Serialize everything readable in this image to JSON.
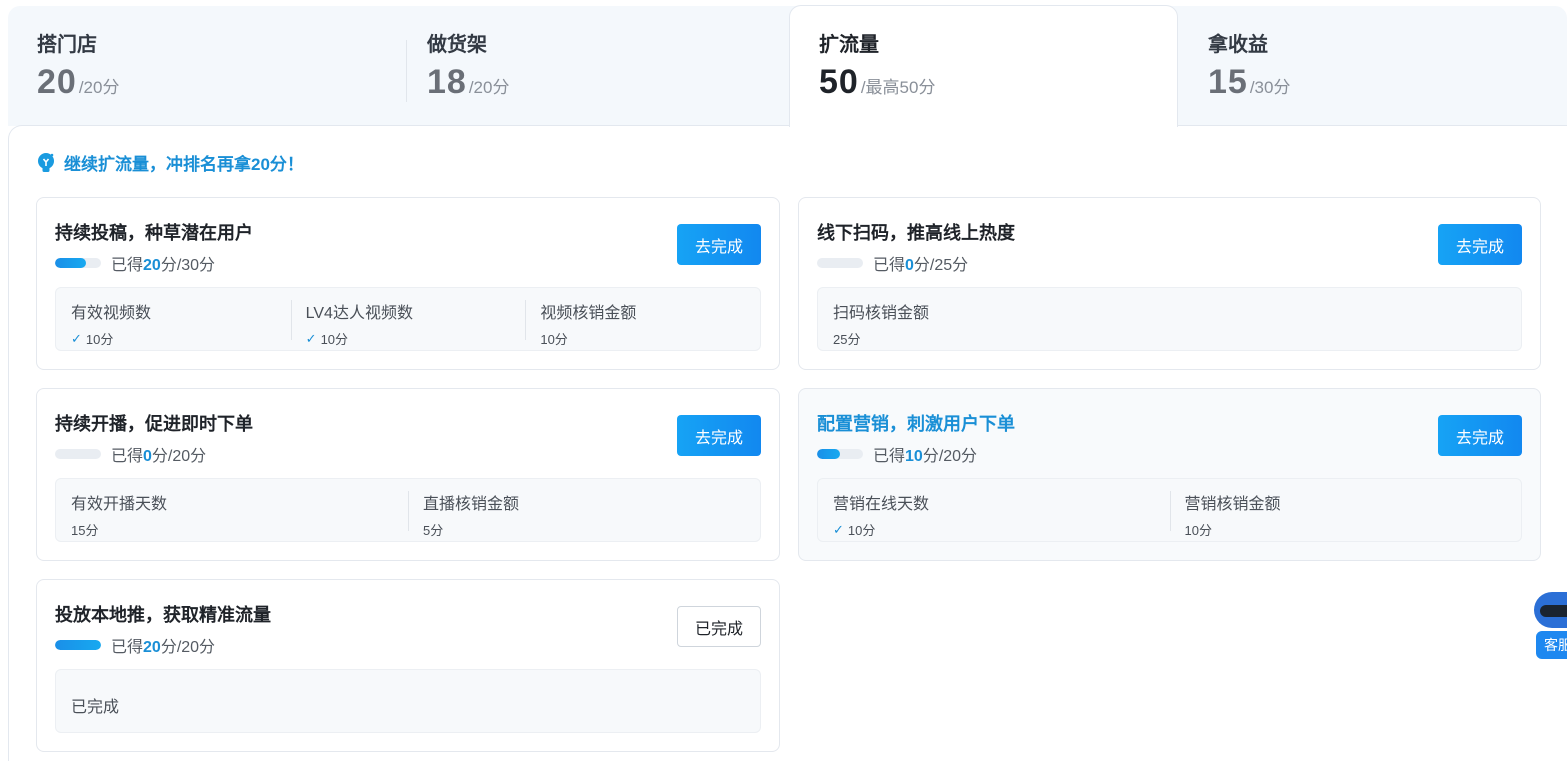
{
  "tabs": [
    {
      "title": "搭门店",
      "score": "20",
      "total": "/20分"
    },
    {
      "title": "做货架",
      "score": "18",
      "total": "/20分"
    },
    {
      "title": "扩流量",
      "score": "50",
      "total": "/最高50分"
    },
    {
      "title": "拿收益",
      "score": "15",
      "total": "/30分"
    }
  ],
  "hint": "继续扩流量，冲排名再拿20分！",
  "progress_prefix": "已得",
  "tasks": [
    {
      "title": "持续投稿，种草潜在用户",
      "earned": "20",
      "total": "分/30分",
      "fraction": 0.667,
      "button": "去完成",
      "items": [
        {
          "label": "有效视频数",
          "value": "10分",
          "checked": true
        },
        {
          "label": "LV4达人视频数",
          "value": "10分",
          "checked": true
        },
        {
          "label": "视频核销金额",
          "value": "10分",
          "checked": false
        }
      ]
    },
    {
      "title": "线下扫码，推高线上热度",
      "earned": "0",
      "total": "分/25分",
      "fraction": 0,
      "button": "去完成",
      "items": [
        {
          "label": "扫码核销金额",
          "value": "25分",
          "checked": false
        }
      ]
    },
    {
      "title": "持续开播，促进即时下单",
      "earned": "0",
      "total": "分/20分",
      "fraction": 0,
      "button": "去完成",
      "items": [
        {
          "label": "有效开播天数",
          "value": "15分",
          "checked": false
        },
        {
          "label": "直播核销金额",
          "value": "5分",
          "checked": false
        }
      ]
    },
    {
      "title": "配置营销，刺激用户下单",
      "earned": "10",
      "total": "分/20分",
      "fraction": 0.5,
      "button": "去完成",
      "items": [
        {
          "label": "营销在线天数",
          "value": "10分",
          "checked": true
        },
        {
          "label": "营销核销金额",
          "value": "10分",
          "checked": false
        }
      ]
    },
    {
      "title": "投放本地推，获取精准流量",
      "earned": "20",
      "total": "分/20分",
      "fraction": 1,
      "button": "已完成",
      "done_text": "已完成"
    }
  ],
  "customer_service": "客服",
  "icons": {
    "hint": "bulb-icon",
    "check": "check-icon",
    "service": "robot-icon"
  },
  "colors": {
    "accent": "#1a8fd6",
    "button": "#1288f0"
  }
}
